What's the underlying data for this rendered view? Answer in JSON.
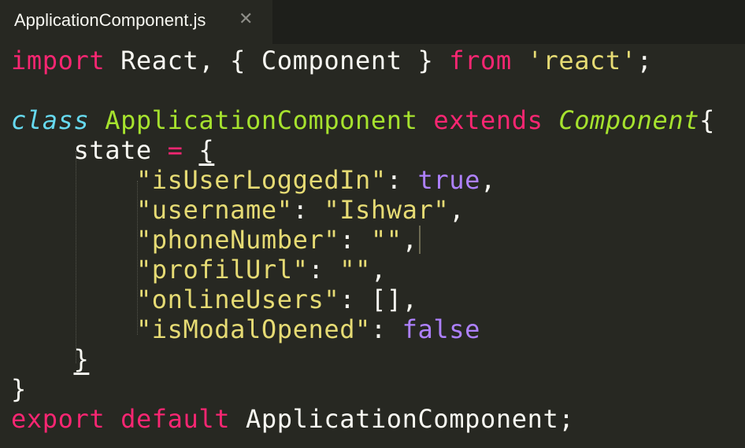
{
  "tab": {
    "title": "ApplicationComponent.js",
    "close_glyph": "✕"
  },
  "code": {
    "l1": {
      "import": "import",
      "p1": " React, { Component } ",
      "from": "from",
      "p2": " ",
      "module": "'react'",
      "p3": ";"
    },
    "l3": {
      "class": "class",
      "p1": " ",
      "name": "ApplicationComponent",
      "p2": " ",
      "extends": "extends",
      "p3": " ",
      "parent": "Component",
      "p4": "{"
    },
    "l4": {
      "indent": "    ",
      "ident": "state",
      "p1": " ",
      "eq": "=",
      "p2": " ",
      "brace": "{"
    },
    "l5": {
      "indent": "        ",
      "key": "\"isUserLoggedIn\"",
      "p1": ": ",
      "val": "true",
      "p2": ","
    },
    "l6": {
      "indent": "        ",
      "key": "\"username\"",
      "p1": ": ",
      "val": "\"Ishwar\"",
      "p2": ","
    },
    "l7": {
      "indent": "        ",
      "key": "\"phoneNumber\"",
      "p1": ": ",
      "val": "\"\"",
      "p2": ","
    },
    "l8": {
      "indent": "        ",
      "key": "\"profilUrl\"",
      "p1": ": ",
      "val": "\"\"",
      "p2": ","
    },
    "l9": {
      "indent": "        ",
      "key": "\"onlineUsers\"",
      "p1": ": ",
      "val": "[]",
      "p2": ","
    },
    "l10": {
      "indent": "        ",
      "key": "\"isModalOpened\"",
      "p1": ": ",
      "val": "false"
    },
    "l11": {
      "indent": "    ",
      "brace": "}"
    },
    "l12": {
      "brace": "}"
    },
    "l13": {
      "export": "export",
      "p1": " ",
      "default": "default",
      "p2": " ",
      "name": "ApplicationComponent",
      "p3": ";"
    }
  },
  "colors": {
    "background": "#272822",
    "keyword": "#f92672",
    "string": "#e6db74",
    "class_name": "#a6e22e",
    "storage": "#66d9ef",
    "constant": "#ae81ff",
    "text": "#f8f8f2"
  }
}
